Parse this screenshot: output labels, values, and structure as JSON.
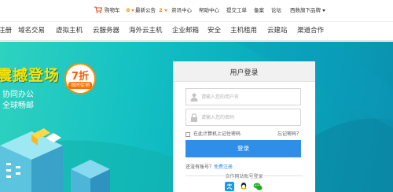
{
  "topbar": {
    "cart_label": "购物车",
    "cart_count": "0",
    "announce_label": "最新公告",
    "announce_count": "2",
    "items": [
      "资讯中心",
      "帮助中心",
      "提交工单",
      "备案",
      "论坛"
    ],
    "brand_label": "西数旗下品牌"
  },
  "nav": {
    "items": [
      "注册",
      "域名交易",
      "虚拟主机",
      "云服务器",
      "海外云主机",
      "企业邮箱",
      "安全",
      "主机租用",
      "云建站",
      "渠道合作"
    ]
  },
  "banner": {
    "title": "震撼登场",
    "subtitle": "协同办公",
    "subtitle2": "全球畅邮",
    "promo_main": "7折",
    "promo_small": "限时促销"
  },
  "login": {
    "title": "用户登录",
    "username_placeholder": "请输入您的用户名",
    "password_placeholder": "请输入您的密码",
    "remember_label": "在此计算机上记住密码",
    "forgot_label": "忘记密码？",
    "submit_label": "登录",
    "register_prefix": "还没有账号？",
    "register_link": "免费注册",
    "partner_label": "合作网站账号登录"
  },
  "colors": {
    "accent": "#2f8ee8",
    "orange": "#f18300",
    "banner": "#13c0c3"
  }
}
